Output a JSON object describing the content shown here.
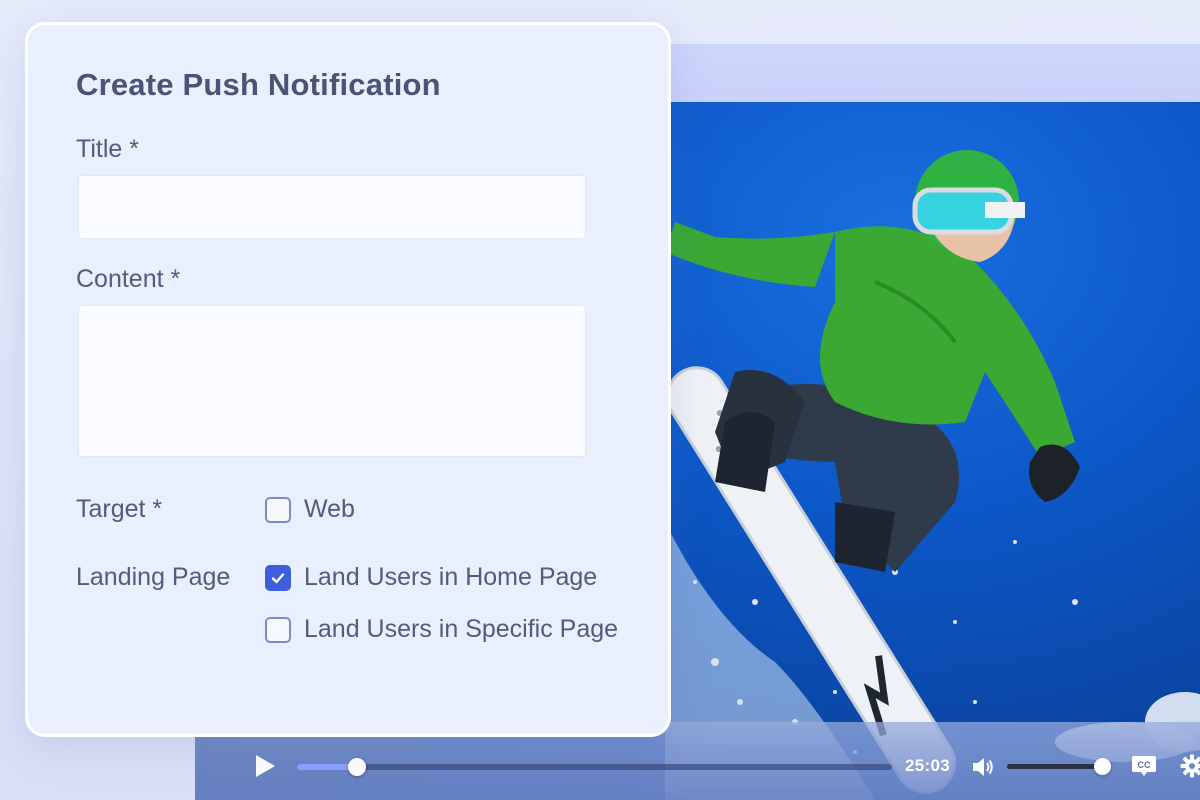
{
  "form": {
    "title": "Create Push Notification",
    "title_field": {
      "label": "Title *",
      "value": "",
      "placeholder": ""
    },
    "content_field": {
      "label": "Content *",
      "value": "",
      "placeholder": ""
    },
    "target": {
      "label": "Target *",
      "options": [
        {
          "label": "Web",
          "checked": false
        }
      ]
    },
    "landing_page": {
      "label": "Landing Page",
      "options": [
        {
          "label": "Land Users in Home Page",
          "checked": true
        },
        {
          "label": "Land Users in Specific Page",
          "checked": false
        }
      ]
    }
  },
  "player": {
    "time": "25:03",
    "progress": 0.1,
    "volume": 1.0,
    "cc_label": "CC",
    "accent_color": "#8aa0ff"
  },
  "colors": {
    "checkbox_checked": "#3d5fdc",
    "card_background": "#e9effc"
  }
}
